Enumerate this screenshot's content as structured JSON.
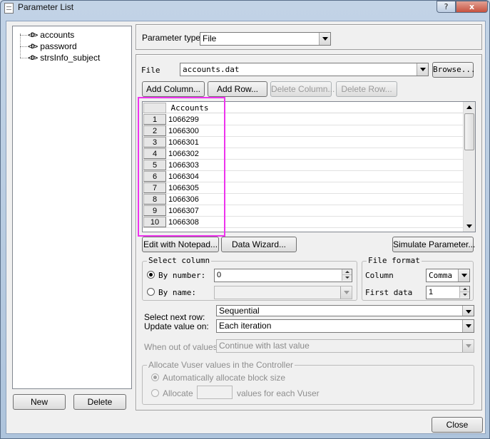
{
  "window": {
    "title": "Parameter List",
    "help_label": "?",
    "close_label": "x"
  },
  "tree": {
    "items": [
      {
        "label": "accounts"
      },
      {
        "label": "password"
      },
      {
        "label": "strsInfo_subject"
      }
    ],
    "icon_text": "<D>"
  },
  "left_buttons": {
    "new": "New",
    "delete": "Delete"
  },
  "parameter_type": {
    "label": "Parameter type:",
    "value": "File"
  },
  "file": {
    "label": "File",
    "value": "accounts.dat",
    "browse": "Browse..."
  },
  "table_buttons": {
    "add_column": "Add Column...",
    "add_row": "Add Row...",
    "delete_column": "Delete Column...",
    "delete_row": "Delete Row..."
  },
  "grid": {
    "column_header": "Accounts",
    "rows": [
      {
        "num": "1",
        "value": "1066299"
      },
      {
        "num": "2",
        "value": "1066300"
      },
      {
        "num": "3",
        "value": "1066301"
      },
      {
        "num": "4",
        "value": "1066302"
      },
      {
        "num": "5",
        "value": "1066303"
      },
      {
        "num": "6",
        "value": "1066304"
      },
      {
        "num": "7",
        "value": "1066305"
      },
      {
        "num": "8",
        "value": "1066306"
      },
      {
        "num": "9",
        "value": "1066307"
      },
      {
        "num": "10",
        "value": "1066308"
      }
    ]
  },
  "action_buttons": {
    "edit_notepad": "Edit with Notepad...",
    "data_wizard": "Data Wizard...",
    "simulate": "Simulate Parameter..."
  },
  "select_column": {
    "title": "Select column",
    "by_number_label": "By number:",
    "by_number_value": "0",
    "by_name_label": "By name:"
  },
  "file_format": {
    "title": "File format",
    "column_label": "Column",
    "column_value": "Comma",
    "first_data_label": "First data",
    "first_data_value": "1"
  },
  "select_next_row": {
    "label": "Select next row:",
    "value": "Sequential"
  },
  "update_value_on": {
    "label": "Update value on:",
    "value": "Each iteration"
  },
  "out_of_values": {
    "label": "When out of values:",
    "value": "Continue with last value"
  },
  "allocate": {
    "title": "Allocate Vuser values in the Controller",
    "auto_label": "Automatically allocate block size",
    "manual_label": "Allocate",
    "manual_suffix": "values for each Vuser"
  },
  "footer": {
    "close": "Close"
  },
  "colors": {
    "highlight": "#ee33ee"
  }
}
